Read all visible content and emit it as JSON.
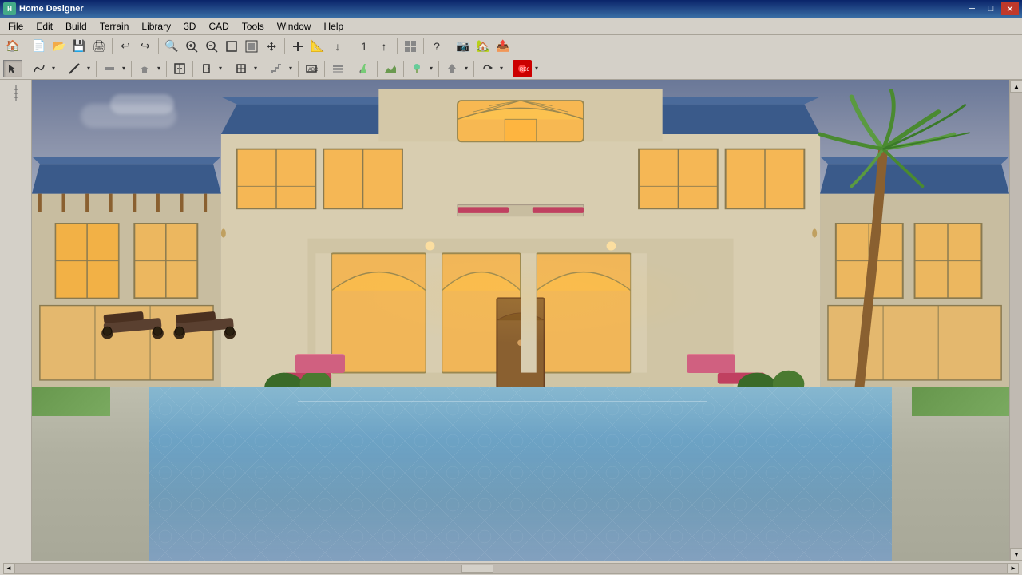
{
  "titleBar": {
    "appName": "Home Designer",
    "winControls": {
      "minimize": "─",
      "maximize": "□",
      "close": "✕",
      "menuMinimize": "─",
      "menuMaximize": "□",
      "menuClose": "✕"
    }
  },
  "menuBar": {
    "items": [
      "File",
      "Edit",
      "Build",
      "Terrain",
      "Library",
      "3D",
      "CAD",
      "Tools",
      "Window",
      "Help"
    ]
  },
  "toolbar1": {
    "buttons": [
      {
        "name": "home-icon",
        "icon": "🏠"
      },
      {
        "name": "new-icon",
        "icon": "📄"
      },
      {
        "name": "open-icon",
        "icon": "📂"
      },
      {
        "name": "save-icon",
        "icon": "💾"
      },
      {
        "name": "print-icon",
        "icon": "🖨"
      },
      {
        "name": "undo-icon",
        "icon": "↩"
      },
      {
        "name": "redo-icon",
        "icon": "↪"
      },
      {
        "name": "zoom-search-icon",
        "icon": "🔍"
      },
      {
        "name": "zoom-in-icon",
        "icon": "🔎"
      },
      {
        "name": "zoom-out-icon",
        "icon": "🔎"
      },
      {
        "name": "zoom-box-icon",
        "icon": "⬜"
      },
      {
        "name": "zoom-fit-icon",
        "icon": "⊞"
      },
      {
        "name": "pan-icon",
        "icon": "✋"
      },
      {
        "name": "add-icon",
        "icon": "＋"
      },
      {
        "name": "measure-icon",
        "icon": "📐"
      },
      {
        "name": "down-arrow-icon",
        "icon": "↓"
      },
      {
        "name": "number-icon",
        "icon": "1"
      },
      {
        "name": "up-arrow-icon",
        "icon": "↑"
      },
      {
        "name": "grid-icon",
        "icon": "⊞"
      },
      {
        "name": "help-question-icon",
        "icon": "?"
      },
      {
        "name": "camera-icon",
        "icon": "📷"
      },
      {
        "name": "house-3d-icon",
        "icon": "🏡"
      },
      {
        "name": "export-icon",
        "icon": "📤"
      }
    ]
  },
  "toolbar2": {
    "buttons": [
      {
        "name": "pointer-tool",
        "icon": "↖",
        "active": true
      },
      {
        "name": "curve-tool",
        "icon": "∿"
      },
      {
        "name": "line-tool",
        "icon": "—"
      },
      {
        "name": "wall-tool",
        "icon": "▬"
      },
      {
        "name": "stamp-tool",
        "icon": "✦"
      },
      {
        "name": "cabinet-tool",
        "icon": "▣"
      },
      {
        "name": "door-tool",
        "icon": "🚪"
      },
      {
        "name": "window-tool",
        "icon": "⊡"
      },
      {
        "name": "stair-tool",
        "icon": "≡"
      },
      {
        "name": "room-tool",
        "icon": "⊞"
      },
      {
        "name": "layer-tool",
        "icon": "⊟"
      },
      {
        "name": "paint-tool",
        "icon": "🎨"
      },
      {
        "name": "terrain-tool",
        "icon": "△"
      },
      {
        "name": "plant-tool",
        "icon": "🌿"
      },
      {
        "name": "move-tool",
        "icon": "✛"
      },
      {
        "name": "rotate-tool",
        "icon": "↻"
      },
      {
        "name": "record-tool",
        "icon": "⏺"
      }
    ]
  },
  "canvas": {
    "renderImage": "Mediterranean luxury home 3D render with pool"
  },
  "statusBar": {
    "scrollLeft": "◄",
    "scrollRight": "►"
  }
}
